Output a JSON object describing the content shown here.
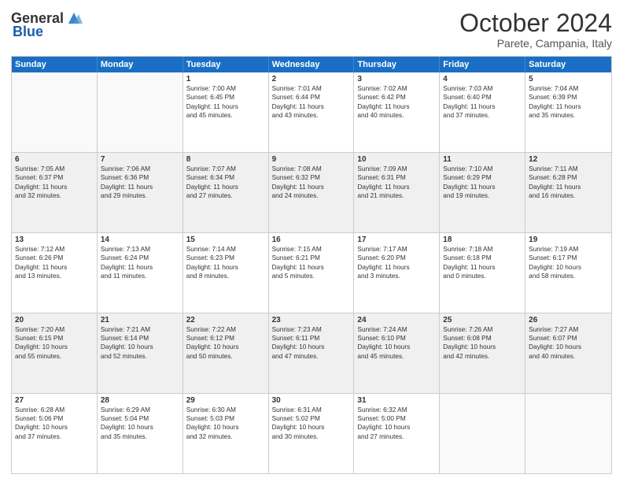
{
  "header": {
    "logo_general": "General",
    "logo_blue": "Blue",
    "month_title": "October 2024",
    "location": "Parete, Campania, Italy"
  },
  "weekdays": [
    "Sunday",
    "Monday",
    "Tuesday",
    "Wednesday",
    "Thursday",
    "Friday",
    "Saturday"
  ],
  "rows": [
    [
      {
        "day": "",
        "lines": [],
        "empty": true
      },
      {
        "day": "",
        "lines": [],
        "empty": true
      },
      {
        "day": "1",
        "lines": [
          "Sunrise: 7:00 AM",
          "Sunset: 6:45 PM",
          "Daylight: 11 hours",
          "and 45 minutes."
        ]
      },
      {
        "day": "2",
        "lines": [
          "Sunrise: 7:01 AM",
          "Sunset: 6:44 PM",
          "Daylight: 11 hours",
          "and 43 minutes."
        ]
      },
      {
        "day": "3",
        "lines": [
          "Sunrise: 7:02 AM",
          "Sunset: 6:42 PM",
          "Daylight: 11 hours",
          "and 40 minutes."
        ]
      },
      {
        "day": "4",
        "lines": [
          "Sunrise: 7:03 AM",
          "Sunset: 6:40 PM",
          "Daylight: 11 hours",
          "and 37 minutes."
        ]
      },
      {
        "day": "5",
        "lines": [
          "Sunrise: 7:04 AM",
          "Sunset: 6:39 PM",
          "Daylight: 11 hours",
          "and 35 minutes."
        ]
      }
    ],
    [
      {
        "day": "6",
        "lines": [
          "Sunrise: 7:05 AM",
          "Sunset: 6:37 PM",
          "Daylight: 11 hours",
          "and 32 minutes."
        ]
      },
      {
        "day": "7",
        "lines": [
          "Sunrise: 7:06 AM",
          "Sunset: 6:36 PM",
          "Daylight: 11 hours",
          "and 29 minutes."
        ]
      },
      {
        "day": "8",
        "lines": [
          "Sunrise: 7:07 AM",
          "Sunset: 6:34 PM",
          "Daylight: 11 hours",
          "and 27 minutes."
        ]
      },
      {
        "day": "9",
        "lines": [
          "Sunrise: 7:08 AM",
          "Sunset: 6:32 PM",
          "Daylight: 11 hours",
          "and 24 minutes."
        ]
      },
      {
        "day": "10",
        "lines": [
          "Sunrise: 7:09 AM",
          "Sunset: 6:31 PM",
          "Daylight: 11 hours",
          "and 21 minutes."
        ]
      },
      {
        "day": "11",
        "lines": [
          "Sunrise: 7:10 AM",
          "Sunset: 6:29 PM",
          "Daylight: 11 hours",
          "and 19 minutes."
        ]
      },
      {
        "day": "12",
        "lines": [
          "Sunrise: 7:11 AM",
          "Sunset: 6:28 PM",
          "Daylight: 11 hours",
          "and 16 minutes."
        ]
      }
    ],
    [
      {
        "day": "13",
        "lines": [
          "Sunrise: 7:12 AM",
          "Sunset: 6:26 PM",
          "Daylight: 11 hours",
          "and 13 minutes."
        ]
      },
      {
        "day": "14",
        "lines": [
          "Sunrise: 7:13 AM",
          "Sunset: 6:24 PM",
          "Daylight: 11 hours",
          "and 11 minutes."
        ]
      },
      {
        "day": "15",
        "lines": [
          "Sunrise: 7:14 AM",
          "Sunset: 6:23 PM",
          "Daylight: 11 hours",
          "and 8 minutes."
        ]
      },
      {
        "day": "16",
        "lines": [
          "Sunrise: 7:15 AM",
          "Sunset: 6:21 PM",
          "Daylight: 11 hours",
          "and 5 minutes."
        ]
      },
      {
        "day": "17",
        "lines": [
          "Sunrise: 7:17 AM",
          "Sunset: 6:20 PM",
          "Daylight: 11 hours",
          "and 3 minutes."
        ]
      },
      {
        "day": "18",
        "lines": [
          "Sunrise: 7:18 AM",
          "Sunset: 6:18 PM",
          "Daylight: 11 hours",
          "and 0 minutes."
        ]
      },
      {
        "day": "19",
        "lines": [
          "Sunrise: 7:19 AM",
          "Sunset: 6:17 PM",
          "Daylight: 10 hours",
          "and 58 minutes."
        ]
      }
    ],
    [
      {
        "day": "20",
        "lines": [
          "Sunrise: 7:20 AM",
          "Sunset: 6:15 PM",
          "Daylight: 10 hours",
          "and 55 minutes."
        ]
      },
      {
        "day": "21",
        "lines": [
          "Sunrise: 7:21 AM",
          "Sunset: 6:14 PM",
          "Daylight: 10 hours",
          "and 52 minutes."
        ]
      },
      {
        "day": "22",
        "lines": [
          "Sunrise: 7:22 AM",
          "Sunset: 6:12 PM",
          "Daylight: 10 hours",
          "and 50 minutes."
        ]
      },
      {
        "day": "23",
        "lines": [
          "Sunrise: 7:23 AM",
          "Sunset: 6:11 PM",
          "Daylight: 10 hours",
          "and 47 minutes."
        ]
      },
      {
        "day": "24",
        "lines": [
          "Sunrise: 7:24 AM",
          "Sunset: 6:10 PM",
          "Daylight: 10 hours",
          "and 45 minutes."
        ]
      },
      {
        "day": "25",
        "lines": [
          "Sunrise: 7:26 AM",
          "Sunset: 6:08 PM",
          "Daylight: 10 hours",
          "and 42 minutes."
        ]
      },
      {
        "day": "26",
        "lines": [
          "Sunrise: 7:27 AM",
          "Sunset: 6:07 PM",
          "Daylight: 10 hours",
          "and 40 minutes."
        ]
      }
    ],
    [
      {
        "day": "27",
        "lines": [
          "Sunrise: 6:28 AM",
          "Sunset: 5:06 PM",
          "Daylight: 10 hours",
          "and 37 minutes."
        ]
      },
      {
        "day": "28",
        "lines": [
          "Sunrise: 6:29 AM",
          "Sunset: 5:04 PM",
          "Daylight: 10 hours",
          "and 35 minutes."
        ]
      },
      {
        "day": "29",
        "lines": [
          "Sunrise: 6:30 AM",
          "Sunset: 5:03 PM",
          "Daylight: 10 hours",
          "and 32 minutes."
        ]
      },
      {
        "day": "30",
        "lines": [
          "Sunrise: 6:31 AM",
          "Sunset: 5:02 PM",
          "Daylight: 10 hours",
          "and 30 minutes."
        ]
      },
      {
        "day": "31",
        "lines": [
          "Sunrise: 6:32 AM",
          "Sunset: 5:00 PM",
          "Daylight: 10 hours",
          "and 27 minutes."
        ]
      },
      {
        "day": "",
        "lines": [],
        "empty": true
      },
      {
        "day": "",
        "lines": [],
        "empty": true
      }
    ]
  ]
}
